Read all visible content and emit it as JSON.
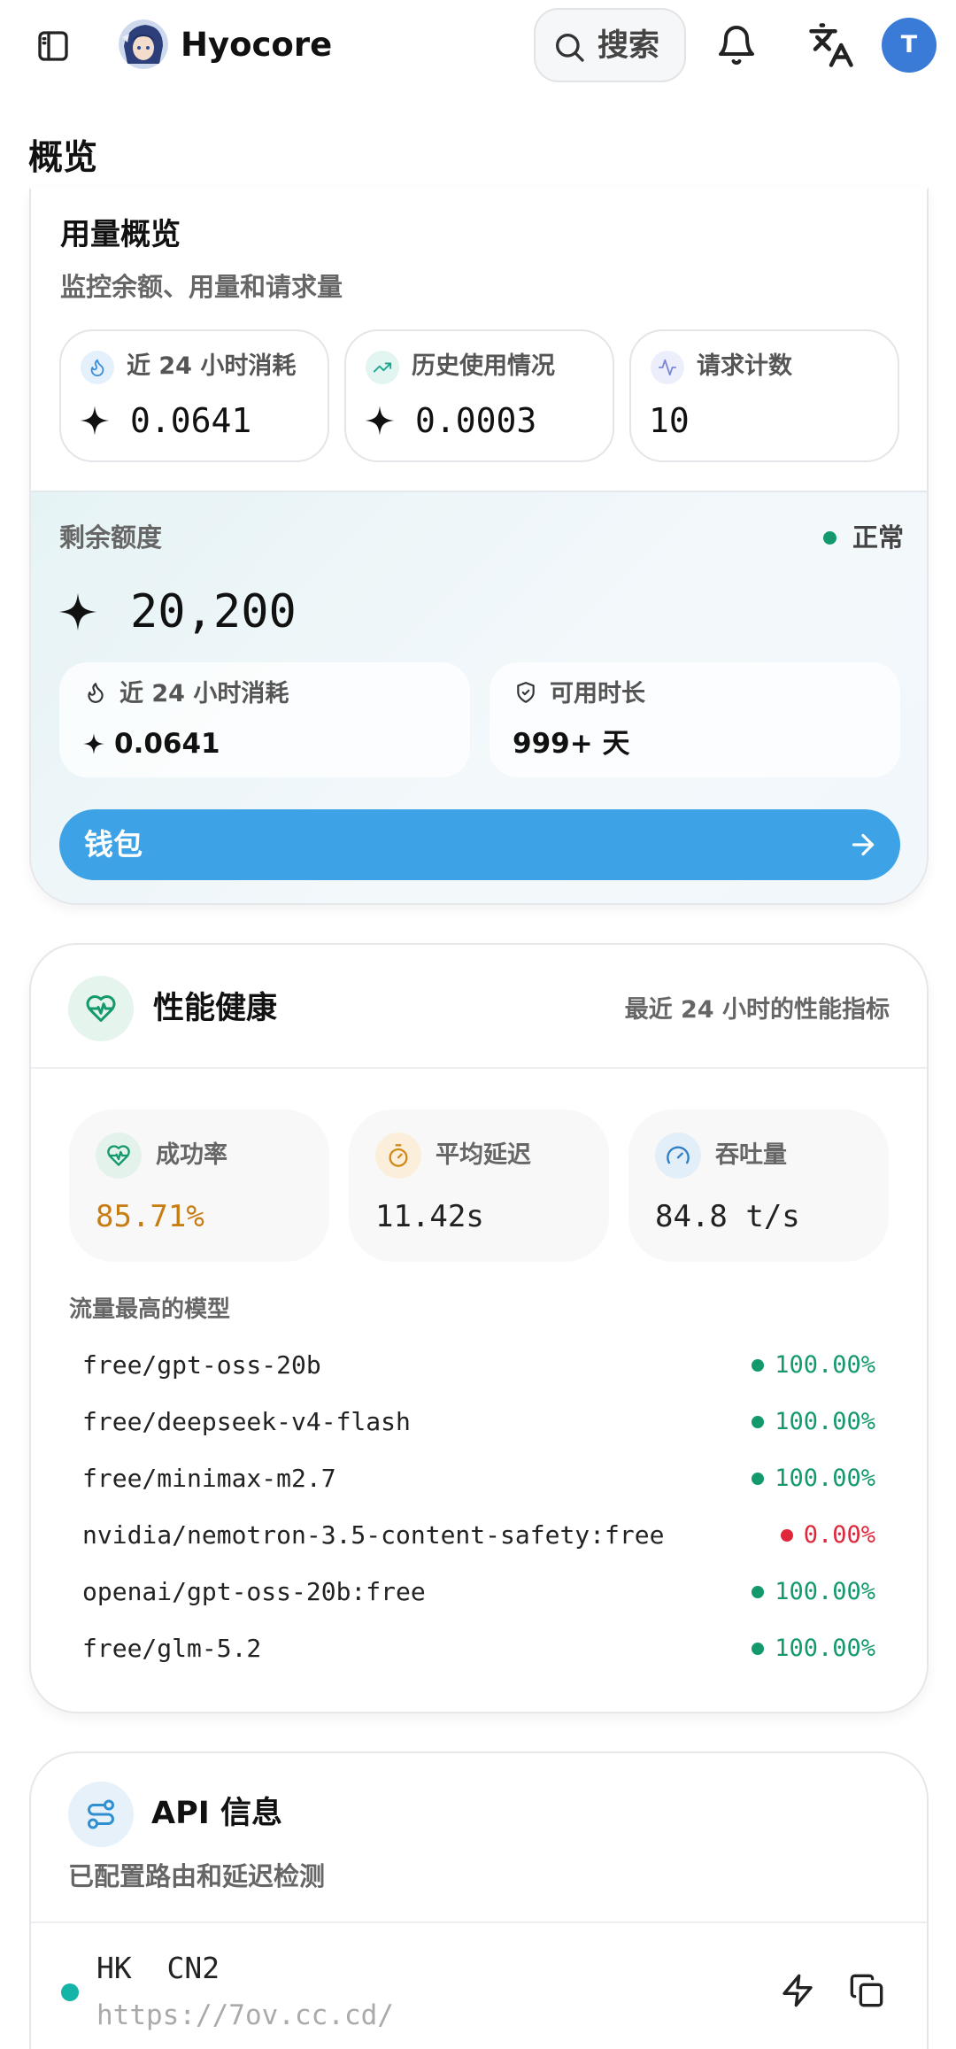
{
  "header": {
    "brand": "Hyocore",
    "search_label": "搜索",
    "avatar_initial": "T"
  },
  "page": {
    "title": "概览"
  },
  "usage": {
    "title": "用量概览",
    "subtitle": "监控余额、用量和请求量",
    "stats": [
      {
        "label": "近 24 小时消耗",
        "value": "0.0641",
        "icon": "flame-icon"
      },
      {
        "label": "历史使用情况",
        "value": "0.0003",
        "icon": "trending-up-icon"
      },
      {
        "label": "请求计数",
        "value": "10",
        "icon": "activity-icon"
      }
    ],
    "balance": {
      "label": "剩余额度",
      "status": "正常",
      "value": "20,200",
      "consumption_label": "近 24 小时消耗",
      "consumption_value": "0.0641",
      "duration_label": "可用时长",
      "duration_value": "999+ 天"
    },
    "wallet_label": "钱包"
  },
  "performance": {
    "title": "性能健康",
    "subtitle": "最近 24 小时的性能指标",
    "metrics": [
      {
        "label": "成功率",
        "value": "85.71%",
        "icon": "heart-pulse-icon"
      },
      {
        "label": "平均延迟",
        "value": "11.42s",
        "icon": "stopwatch-icon"
      },
      {
        "label": "吞吐量",
        "value": "84.8 t/s",
        "icon": "gauge-icon"
      }
    ],
    "models_title": "流量最高的模型",
    "models": [
      {
        "name": "free/gpt-oss-20b",
        "rate": "100.00%",
        "status": "ok"
      },
      {
        "name": "free/deepseek-v4-flash",
        "rate": "100.00%",
        "status": "ok"
      },
      {
        "name": "free/minimax-m2.7",
        "rate": "100.00%",
        "status": "ok"
      },
      {
        "name": "nvidia/nemotron-3.5-content-safety:free",
        "rate": "0.00%",
        "status": "error"
      },
      {
        "name": "openai/gpt-oss-20b:free",
        "rate": "100.00%",
        "status": "ok"
      },
      {
        "name": "free/glm-5.2",
        "rate": "100.00%",
        "status": "ok"
      }
    ]
  },
  "api": {
    "title": "API 信息",
    "subtitle": "已配置路由和延迟检测",
    "routes": [
      {
        "name": "HK  CN2",
        "url": "https://7ov.cc.cd/"
      }
    ]
  },
  "colors": {
    "accent_blue": "#3ea2e6",
    "ok_green": "#13996b",
    "error_red": "#e0263a",
    "warn_orange": "#c87d12"
  }
}
